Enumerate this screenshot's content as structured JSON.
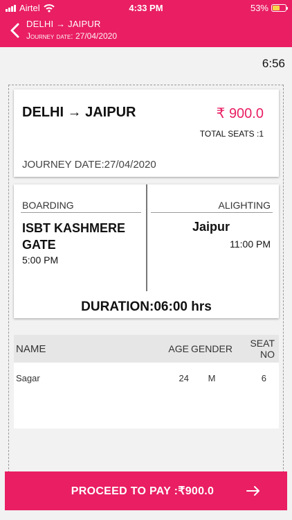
{
  "status_bar": {
    "carrier": "Airtel",
    "time": "4:33 PM",
    "battery": "53%",
    "battery_level": 0.53
  },
  "header": {
    "title": "DELHI → JAIPUR",
    "subtitle": "Journey date: 27/04/2020"
  },
  "timer": "6:56",
  "route_card": {
    "route": "DELHI → JAIPUR",
    "price": "₹ 900.0",
    "total_seats": "TOTAL SEATS :1",
    "journey_date": "JOURNEY DATE:27/04/2020"
  },
  "journey_card": {
    "boarding_label": "BOARDING",
    "boarding_place": "ISBT KASHMERE GATE",
    "boarding_time": "5:00 PM",
    "alighting_label": "ALIGHTING",
    "alighting_place": "Jaipur",
    "alighting_time": "11:00 PM",
    "duration": "DURATION:06:00 hrs"
  },
  "passengers": {
    "headers": {
      "name": "NAME",
      "age": "AGE",
      "gender": "GENDER",
      "seat": "SEAT NO"
    },
    "rows": [
      {
        "name": "Sagar",
        "age": "24",
        "gender": "M",
        "seat": "6"
      }
    ]
  },
  "proceed_button": {
    "label": "PROCEED TO PAY :₹900.0"
  },
  "colors": {
    "accent": "#e91e63"
  }
}
